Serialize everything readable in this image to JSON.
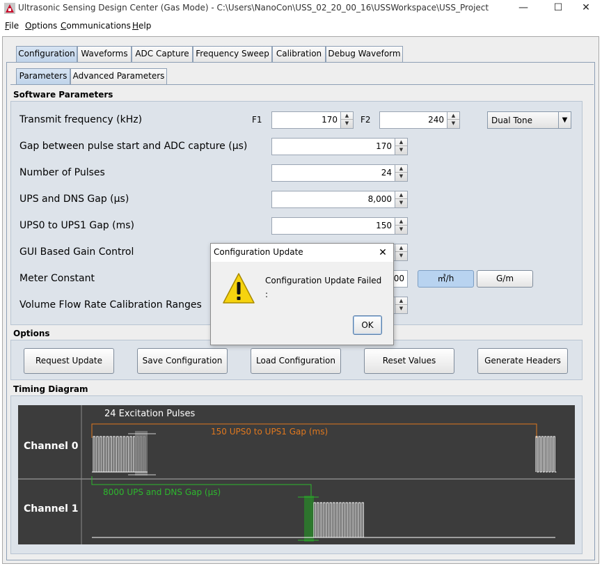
{
  "window": {
    "title": "Ultrasonic Sensing Design Center (Gas Mode) - C:\\Users\\NanoCon\\USS_02_20_00_16\\USSWorkspace\\USS_Project",
    "minimize": "—",
    "maximize": "☐",
    "close": "✕"
  },
  "menu": [
    "File",
    "Options",
    "Communications",
    "Help"
  ],
  "tabs": [
    "Configuration",
    "Waveforms",
    "ADC Capture",
    "Frequency Sweep",
    "Calibration",
    "Debug Waveform"
  ],
  "subtabs": [
    "Parameters",
    "Advanced Parameters"
  ],
  "software_parameters": {
    "title": "Software Parameters",
    "transmit_frequency": {
      "label": "Transmit frequency (kHz)",
      "f1_label": "F1",
      "f1": "170",
      "f2_label": "F2",
      "f2": "240",
      "mode": "Dual Tone"
    },
    "gap_pulse_adc": {
      "label": "Gap between pulse start and ADC capture (µs)",
      "value": "170"
    },
    "num_pulses": {
      "label": "Number of Pulses",
      "value": "24"
    },
    "ups_dns_gap": {
      "label": "UPS and DNS Gap (µs)",
      "value": "8,000"
    },
    "ups0_ups1_gap": {
      "label": "UPS0 to UPS1 Gap (ms)",
      "value": "150"
    },
    "gui_gain": {
      "label": "GUI Based Gain Control"
    },
    "meter_constant": {
      "label": "Meter Constant",
      "value": "00",
      "unit_a": "㎥/h",
      "unit_b": "G/m"
    },
    "volume_flow": {
      "label": "Volume Flow Rate Calibration Ranges"
    }
  },
  "options": {
    "title": "Options",
    "buttons": [
      "Request Update",
      "Save Configuration",
      "Load Configuration",
      "Reset Values",
      "Generate Headers"
    ]
  },
  "timing": {
    "title": "Timing Diagram",
    "channel0": "Channel 0",
    "channel1": "Channel 1",
    "excitation": "24 Excitation Pulses",
    "ups_gap": "150 UPS0 to UPS1 Gap (ms)",
    "dns_gap": "8000 UPS and DNS Gap (µs)"
  },
  "dialog": {
    "title": "Configuration Update",
    "message": "Configuration Update Failed",
    "detail": ":",
    "ok": "OK",
    "close": "✕"
  },
  "colors": {
    "orange": "#e0781e",
    "green": "#2db82d",
    "timing_bg": "#3c3c3c",
    "toggle_active": "#b8d3f0"
  }
}
